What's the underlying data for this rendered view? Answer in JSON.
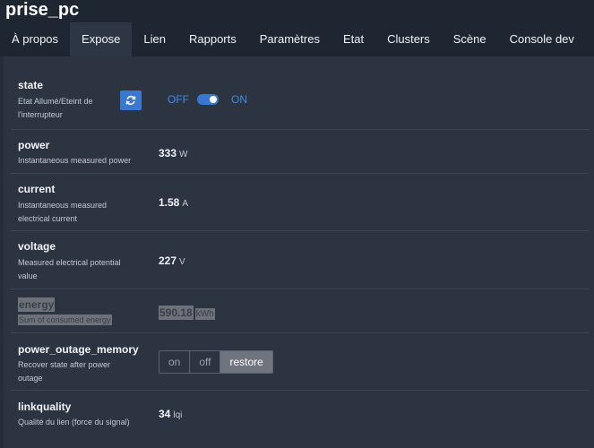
{
  "app": {
    "title": "prise_pc"
  },
  "tabs": [
    "À propos",
    "Expose",
    "Lien",
    "Rapports",
    "Paramètres",
    "Etat",
    "Clusters",
    "Scène",
    "Console dev"
  ],
  "state": {
    "name": "state",
    "desc": "Etat Allumé/Eteint de l'interrupteur",
    "off_label": "OFF",
    "on_label": "ON",
    "value": "ON",
    "refresh_icon": "refresh-icon"
  },
  "power": {
    "name": "power",
    "desc": "Instantaneous measured power",
    "value": "333",
    "unit": "W"
  },
  "current": {
    "name": "current",
    "desc": "Instantaneous measured electrical current",
    "value": "1.58",
    "unit": "A"
  },
  "voltage": {
    "name": "voltage",
    "desc": "Measured electrical potential value",
    "value": "227",
    "unit": "V"
  },
  "energy": {
    "name": "energy",
    "desc": "Sum of consumed energy",
    "value": "590.18",
    "unit": "kWh"
  },
  "power_outage_memory": {
    "name": "power_outage_memory",
    "desc": "Recover state after power outage",
    "options": [
      "on",
      "off",
      "restore"
    ],
    "selected": "restore"
  },
  "linkquality": {
    "name": "linkquality",
    "desc": "Qualité du lien (force du signal)",
    "value": "34",
    "unit": "lqi"
  },
  "colors": {
    "accent": "#3a78d0",
    "toggle_text": "#3e8de8",
    "background": "#262c38",
    "panel": "#2c3442"
  }
}
